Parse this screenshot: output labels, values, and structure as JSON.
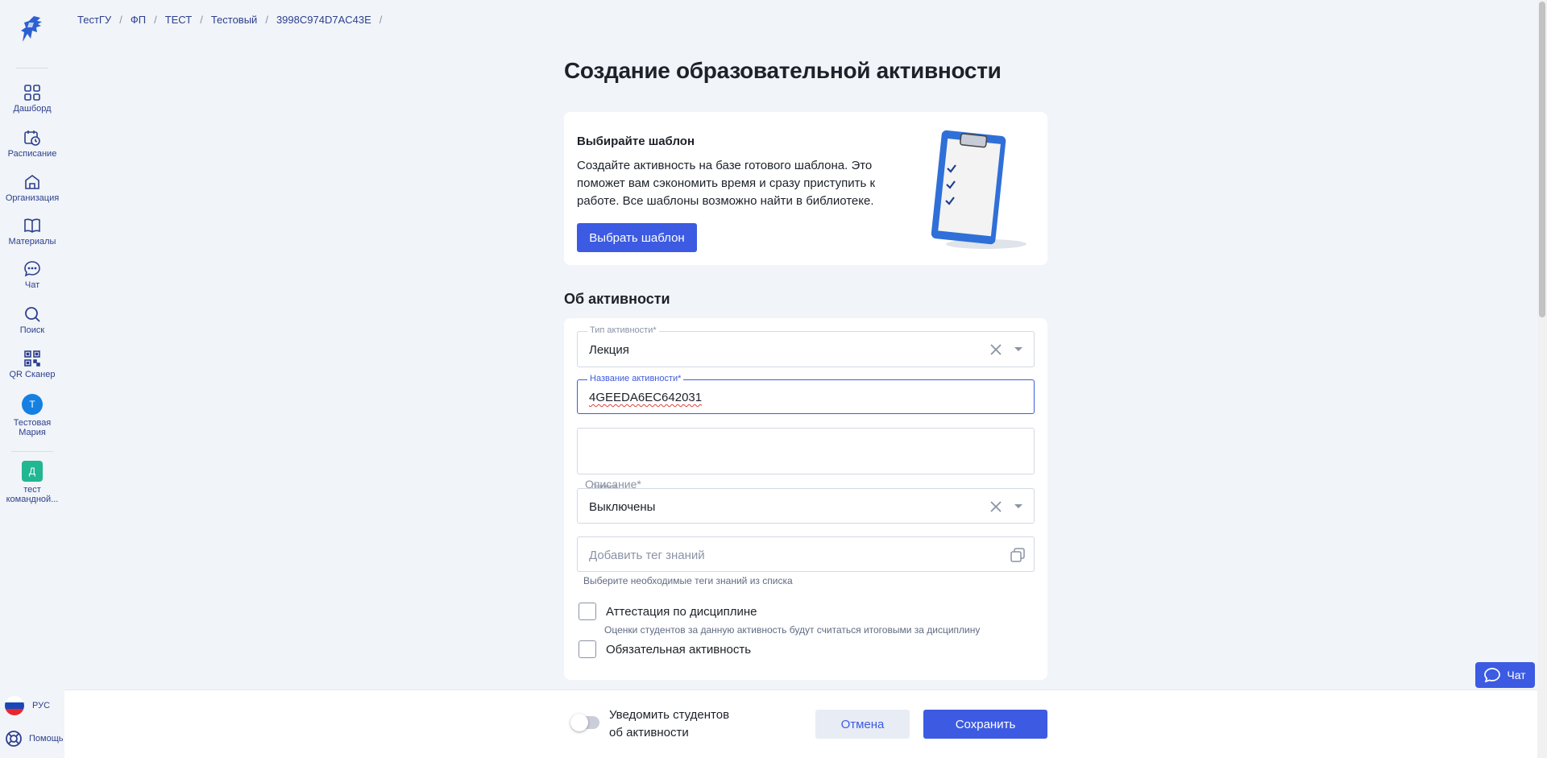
{
  "breadcrumb": [
    "ТестГУ",
    "ФП",
    "ТЕСТ",
    "Тестовый",
    "3998C974D7AC43E"
  ],
  "sidebar": {
    "items": [
      {
        "label": "Дашборд",
        "icon": "grid-icon"
      },
      {
        "label": "Расписание",
        "icon": "calendar-clock-icon"
      },
      {
        "label": "Организация",
        "icon": "building-icon"
      },
      {
        "label": "Материалы",
        "icon": "book-icon"
      },
      {
        "label": "Чат",
        "icon": "chat-bubble-icon"
      },
      {
        "label": "Поиск",
        "icon": "search-icon"
      },
      {
        "label": "QR Сканер",
        "icon": "qr-code-icon"
      }
    ],
    "user": {
      "initial": "Т",
      "name": "Тестовая Мария"
    },
    "team": {
      "initial": "Д",
      "name": "тест командной..."
    },
    "language": "РУС",
    "help": "Помощь"
  },
  "page": {
    "title": "Создание образовательной активности"
  },
  "template_card": {
    "title": "Выбирайте шаблон",
    "text": "Создайте активность на базе готового шаблона. Это поможет вам сэкономить время и сразу приступить к работе. Все шаблоны возможно найти в библиотеке.",
    "button": "Выбрать шаблон"
  },
  "about": {
    "title": "Об активности",
    "type_label": "Тип активности*",
    "type_value": "Лекция",
    "name_label": "Название активности*",
    "name_value": "4GEEDA6EC642031",
    "description_label": "Описание*",
    "grades_label": "Оценки",
    "grades_value": "Выключены",
    "tags_placeholder": "Добавить тег знаний",
    "tags_hint": "Выберите необходимые теги знаний из списка",
    "attestation_label": "Аттестация по дисциплине",
    "attestation_hint": "Оценки студентов за данную активность будут считаться итоговыми за дисциплину",
    "mandatory_label": "Обязательная активность"
  },
  "footer": {
    "notify_text": "Уведомить студентов об активности",
    "notify_on": false,
    "cancel": "Отмена",
    "save": "Сохранить"
  },
  "chat_button": "Чат",
  "colors": {
    "accent": "#3c5be2",
    "background": "#f1f4f8",
    "nav": "#2c3f8e"
  }
}
